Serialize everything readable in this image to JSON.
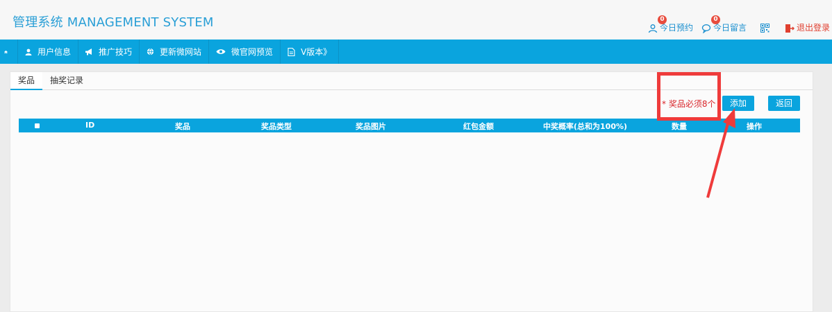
{
  "header": {
    "brand": "管理系统 MANAGEMENT SYSTEM",
    "appointments": {
      "label": "今日预约",
      "count": "0"
    },
    "messages": {
      "label": "今日留言",
      "count": "0"
    },
    "logout": "退出登录"
  },
  "nav": {
    "items": [
      {
        "label": "用户信息"
      },
      {
        "label": "推广技巧"
      },
      {
        "label": "更新微网站"
      },
      {
        "label": "微官网预览"
      },
      {
        "label": "V版本》"
      }
    ]
  },
  "tabs": [
    "奖品",
    "抽奖记录"
  ],
  "toolbar": {
    "notice": "* 奖品必须8个",
    "add_label": "添加",
    "back_label": "返回"
  },
  "table": {
    "columns": [
      "ID",
      "奖品",
      "奖品类型",
      "奖品图片",
      "红包金额",
      "中奖概率(总和为100%)",
      "数量",
      "操作"
    ]
  },
  "colors": {
    "accent": "#0aa4de",
    "annotation": "#ef3b3b",
    "notice": "#d9252a"
  }
}
